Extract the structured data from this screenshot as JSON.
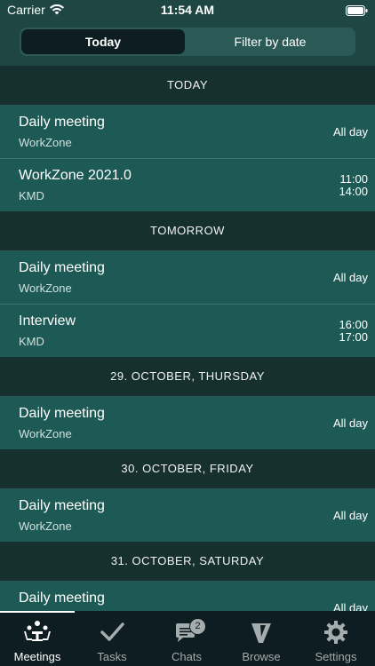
{
  "status_bar": {
    "carrier": "Carrier",
    "time": "11:54 AM"
  },
  "segments": {
    "today": "Today",
    "filter": "Filter by date"
  },
  "sections": [
    {
      "header": "TODAY",
      "rows": [
        {
          "title": "Daily meeting",
          "subtitle": "WorkZone",
          "allday": "All day"
        },
        {
          "title": "WorkZone 2021.0",
          "subtitle": "KMD",
          "start": "11:00",
          "end": "14:00"
        }
      ]
    },
    {
      "header": "TOMORROW",
      "rows": [
        {
          "title": "Daily meeting",
          "subtitle": "WorkZone",
          "allday": "All day"
        },
        {
          "title": "Interview",
          "subtitle": "KMD",
          "start": "16:00",
          "end": "17:00"
        }
      ]
    },
    {
      "header": "29. OCTOBER, THURSDAY",
      "rows": [
        {
          "title": "Daily meeting",
          "subtitle": "WorkZone",
          "allday": "All day"
        }
      ]
    },
    {
      "header": "30. OCTOBER, FRIDAY",
      "rows": [
        {
          "title": "Daily meeting",
          "subtitle": "WorkZone",
          "allday": "All day"
        }
      ]
    },
    {
      "header": "31. OCTOBER, SATURDAY",
      "rows": [
        {
          "title": "Daily meeting",
          "subtitle": "",
          "allday": "All day"
        }
      ]
    }
  ],
  "tabbar": {
    "meetings": "Meetings",
    "tasks": "Tasks",
    "chats": "Chats",
    "chats_badge": "2",
    "browse": "Browse",
    "settings": "Settings"
  },
  "colors": {
    "background": "#1e4744",
    "row": "#1e5a55",
    "section": "#16302f",
    "tabbar": "#0e1d21"
  }
}
